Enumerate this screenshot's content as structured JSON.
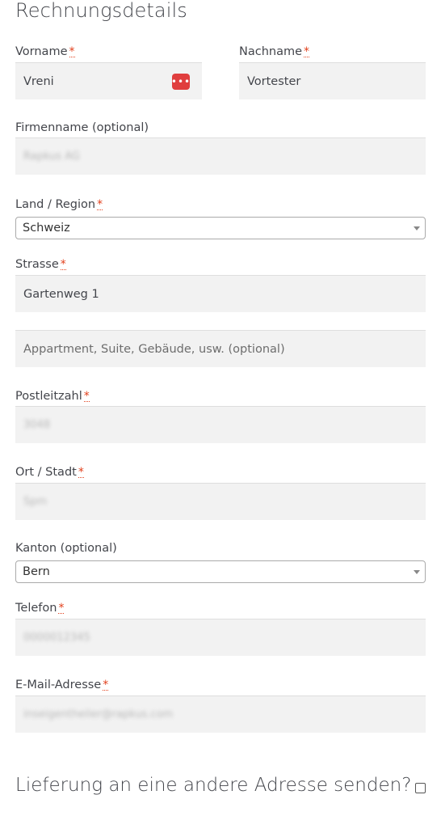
{
  "form": {
    "title": "Rechnungsdetails",
    "required_marker": "*",
    "first_name": {
      "label": "Vorname",
      "value": "Vreni"
    },
    "last_name": {
      "label": "Nachname",
      "value": "Vortester"
    },
    "company": {
      "label": "Firmenname (optional)",
      "value": "Rapkus AG"
    },
    "country": {
      "label": "Land / Region",
      "value": "Schweiz"
    },
    "street": {
      "label": "Strasse",
      "value": "Gartenweg 1",
      "line2_placeholder": "Appartment, Suite, Gebäude, usw. (optional)"
    },
    "postcode": {
      "label": "Postleitzahl",
      "value": "3048"
    },
    "city": {
      "label": "Ort / Stadt",
      "value": "Spm"
    },
    "state": {
      "label": "Kanton (optional)",
      "value": "Bern"
    },
    "phone": {
      "label": "Telefon",
      "value": "0000012345"
    },
    "email": {
      "label": "E-Mail-Adresse",
      "value": "inseigentheiler@rapkus.com"
    }
  },
  "shipping": {
    "label": "Lieferung an eine andere Adresse senden?"
  },
  "icons": {
    "password_manager": "password-manager-icon",
    "dropdown": "chevron-down-icon"
  },
  "colors": {
    "required": "#e2401c",
    "field_bg": "#f2f2f2",
    "icon_red": "#e03e3e"
  }
}
